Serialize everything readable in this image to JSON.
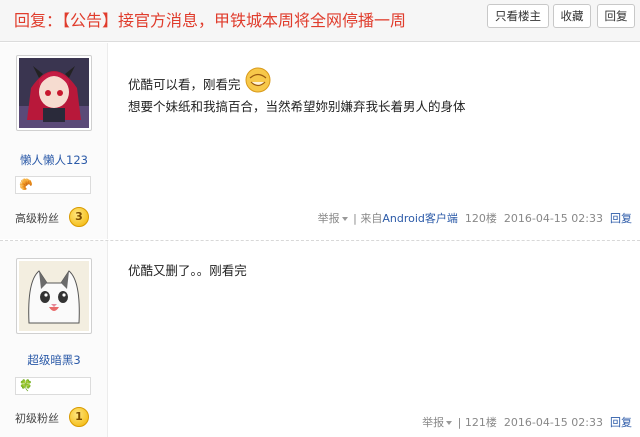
{
  "header": {
    "title": "回复：【公告】接官方消息，甲铁城本周将全网停播一周",
    "btn_only_op": "只看楼主",
    "btn_favorite": "收藏",
    "btn_reply": "回复"
  },
  "posts": [
    {
      "username": "懒人懒人123",
      "badge_icon": "🥐",
      "level_label": "高级粉丝",
      "level_num": "3",
      "lines": [
        "优酷可以看，刚看完",
        "想要个妹纸和我搞百合，当然希望妳别嫌弃我长着男人的身体"
      ],
      "report": "举报",
      "source_prefix": "| 来自",
      "source_link": "Android客户端",
      "floor": "120楼",
      "time": "2016-04-15 02:33",
      "reply": "回复"
    },
    {
      "username": "超级暗黑3",
      "badge_icon": "🍀",
      "level_label": "初级粉丝",
      "level_num": "1",
      "lines": [
        "优酷又删了。。刚看完"
      ],
      "report": "举报",
      "floor": "| 121楼",
      "time": "2016-04-15 02:33",
      "reply": "回复"
    }
  ],
  "colors": {
    "title": "#e03c2c",
    "link": "#2b5aa8",
    "level_badge": "#f2b400"
  }
}
